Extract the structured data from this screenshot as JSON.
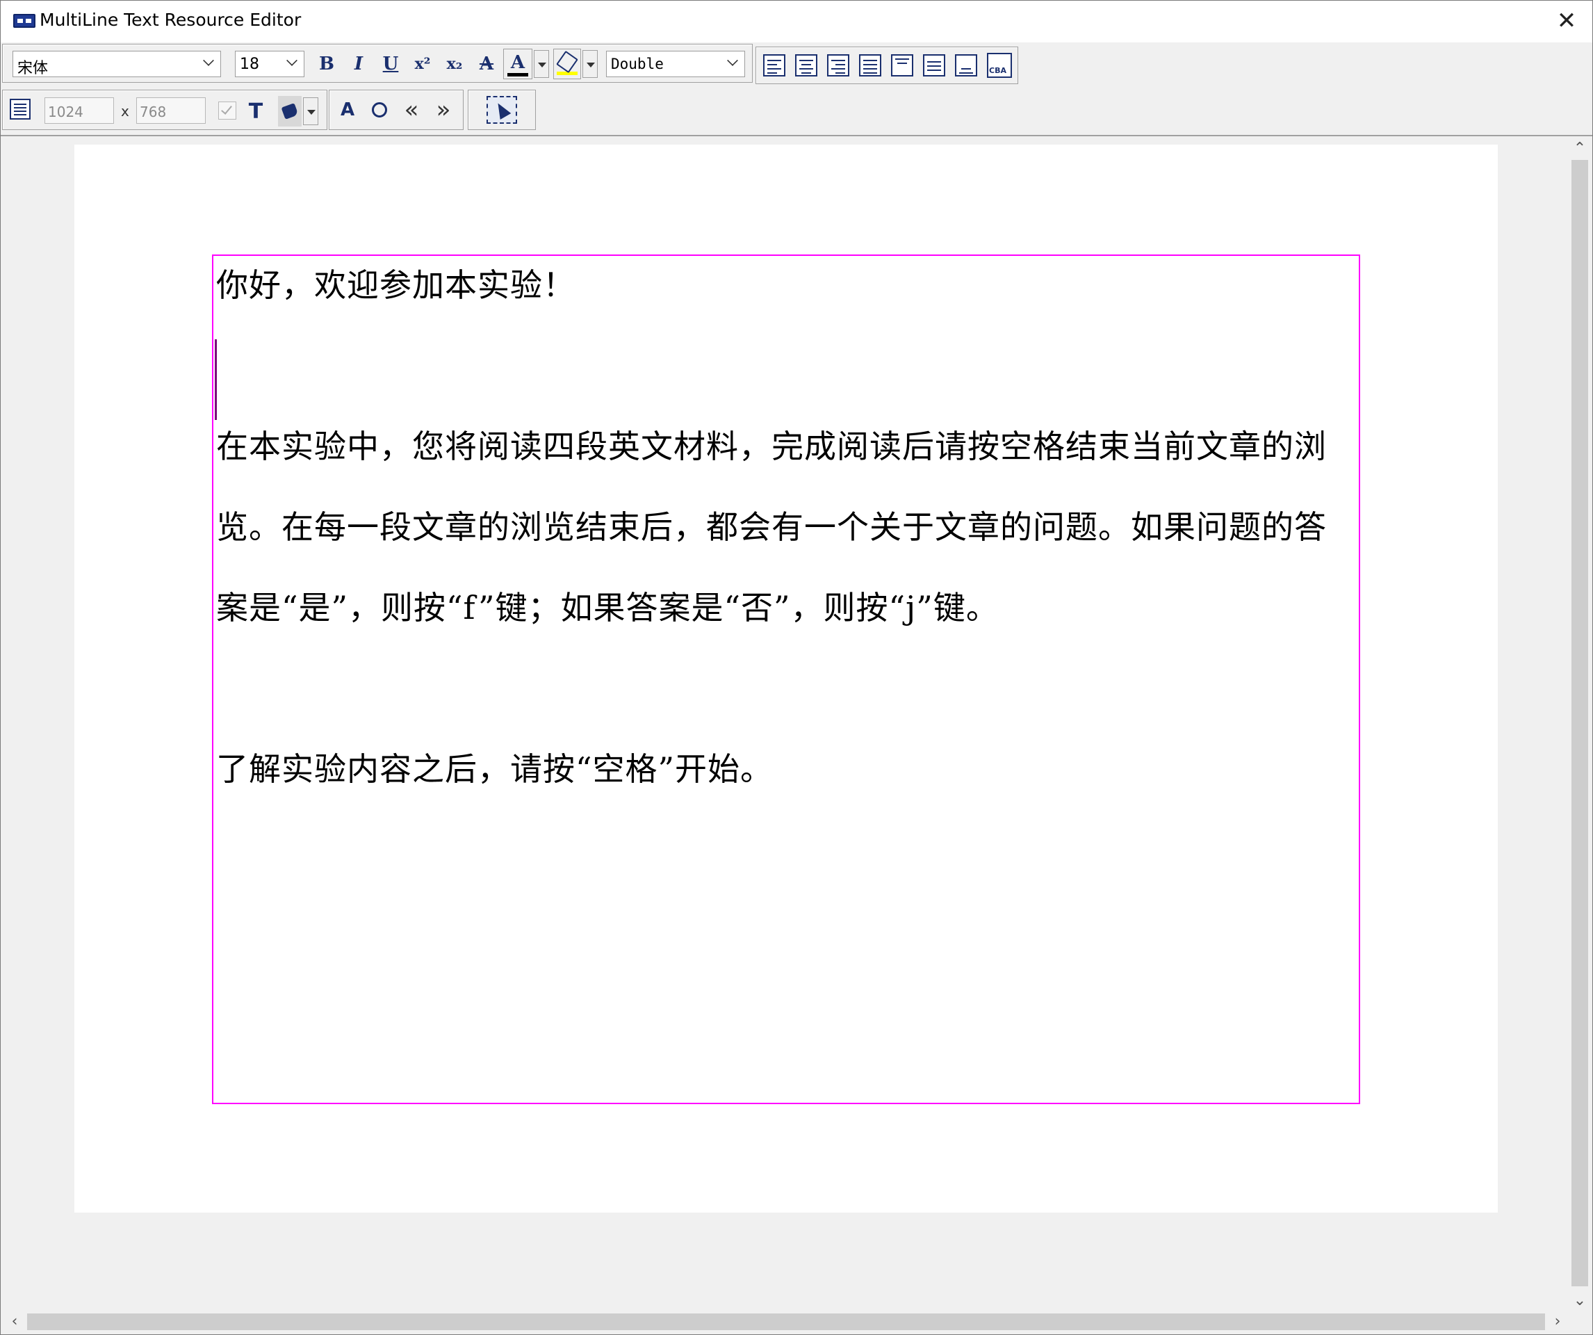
{
  "window": {
    "title": "MultiLine Text Resource Editor",
    "close": "✕"
  },
  "toolbar": {
    "font_name": "宋体",
    "font_size": "18",
    "bold": "B",
    "italic": "I",
    "underline": "U",
    "superscript": "x²",
    "subscript": "x₂",
    "strike": "A",
    "text_color": "A",
    "line_spacing": "Double",
    "width": "1024",
    "x_label": "x",
    "height": "768",
    "prev": "«",
    "next": "»",
    "rtl_label": "CBA",
    "colors": {
      "text_color_bar": "#000000",
      "highlight_bar": "#ffff00",
      "accent": "#1a2f6e"
    }
  },
  "document": {
    "lines": [
      "你好，欢迎参加本实验！",
      "在本实验中，您将阅读四段英文材料，完成阅读后请按空格结束当前文章的浏",
      "览。在每一段文章的浏览结束后，都会有一个关于文章的问题。如果问题的答",
      "案是“是”，则按“f”键；如果答案是“否”，则按“j”键。",
      "了解实验内容之后，请按“空格”开始。"
    ],
    "textbox_border": "#ff00ff"
  }
}
